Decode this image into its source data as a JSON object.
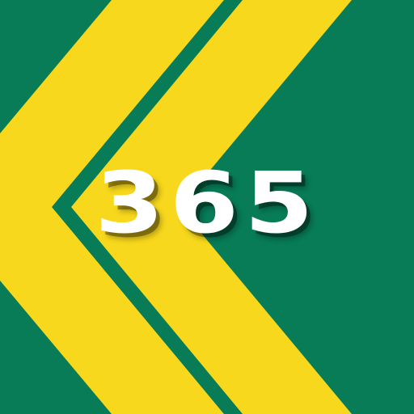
{
  "logo": {
    "text": "365"
  },
  "colors": {
    "green": "#077c57",
    "yellow": "#f8d81c",
    "text": "#ffffff"
  }
}
